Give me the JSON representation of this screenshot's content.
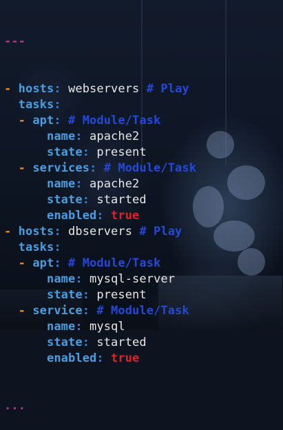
{
  "document": {
    "start_marker": "---",
    "end_marker": "...",
    "lines": [
      {
        "id": "l1",
        "dash": "- ",
        "indent": "",
        "key": "hosts",
        "colon": ": ",
        "value": "webservers",
        "comment": " # Play"
      },
      {
        "id": "l2",
        "dash": "",
        "indent": "  ",
        "key": "tasks",
        "colon": ":",
        "value": "",
        "comment": ""
      },
      {
        "id": "l3",
        "dash": "- ",
        "indent": "  ",
        "key": "apt",
        "colon": ": ",
        "value": "",
        "comment": "# Module/Task"
      },
      {
        "id": "l4",
        "dash": "",
        "indent": "      ",
        "key": "name",
        "colon": ": ",
        "value": "apache2",
        "comment": ""
      },
      {
        "id": "l5",
        "dash": "",
        "indent": "      ",
        "key": "state",
        "colon": ": ",
        "value": "present",
        "comment": ""
      },
      {
        "id": "l6",
        "dash": "- ",
        "indent": "  ",
        "key": "services",
        "colon": ": ",
        "value": "",
        "comment": "# Module/Task"
      },
      {
        "id": "l7",
        "dash": "",
        "indent": "      ",
        "key": "name",
        "colon": ": ",
        "value": "apache2",
        "comment": ""
      },
      {
        "id": "l8",
        "dash": "",
        "indent": "      ",
        "key": "state",
        "colon": ": ",
        "value": "started",
        "comment": ""
      },
      {
        "id": "l9",
        "dash": "",
        "indent": "      ",
        "key": "enabled",
        "colon": ": ",
        "value": "true",
        "comment": "",
        "bool": true
      },
      {
        "id": "l10",
        "dash": "- ",
        "indent": "",
        "key": "hosts",
        "colon": ": ",
        "value": "dbservers",
        "comment": " # Play"
      },
      {
        "id": "l11",
        "dash": "",
        "indent": "  ",
        "key": "tasks",
        "colon": ":",
        "value": "",
        "comment": ""
      },
      {
        "id": "l12",
        "dash": "- ",
        "indent": "  ",
        "key": "apt",
        "colon": ": ",
        "value": "",
        "comment": "# Module/Task"
      },
      {
        "id": "l13",
        "dash": "",
        "indent": "      ",
        "key": "name",
        "colon": ": ",
        "value": "mysql-server",
        "comment": ""
      },
      {
        "id": "l14",
        "dash": "",
        "indent": "      ",
        "key": "state",
        "colon": ": ",
        "value": "present",
        "comment": ""
      },
      {
        "id": "l15",
        "dash": "- ",
        "indent": "  ",
        "key": "service",
        "colon": ": ",
        "value": "",
        "comment": "# Module/Task"
      },
      {
        "id": "l16",
        "dash": "",
        "indent": "      ",
        "key": "name",
        "colon": ": ",
        "value": "mysql",
        "comment": ""
      },
      {
        "id": "l17",
        "dash": "",
        "indent": "      ",
        "key": "state",
        "colon": ": ",
        "value": "started",
        "comment": ""
      },
      {
        "id": "l18",
        "dash": "",
        "indent": "      ",
        "key": "enabled",
        "colon": ": ",
        "value": "true",
        "comment": "",
        "bool": true
      }
    ]
  },
  "colors": {
    "key": "#4a9ee0",
    "comment": "#2448d8",
    "value": "#e8e8e8",
    "dash": "#e88a2a",
    "boolean": "#e0202a",
    "marker": "#b5388c"
  }
}
